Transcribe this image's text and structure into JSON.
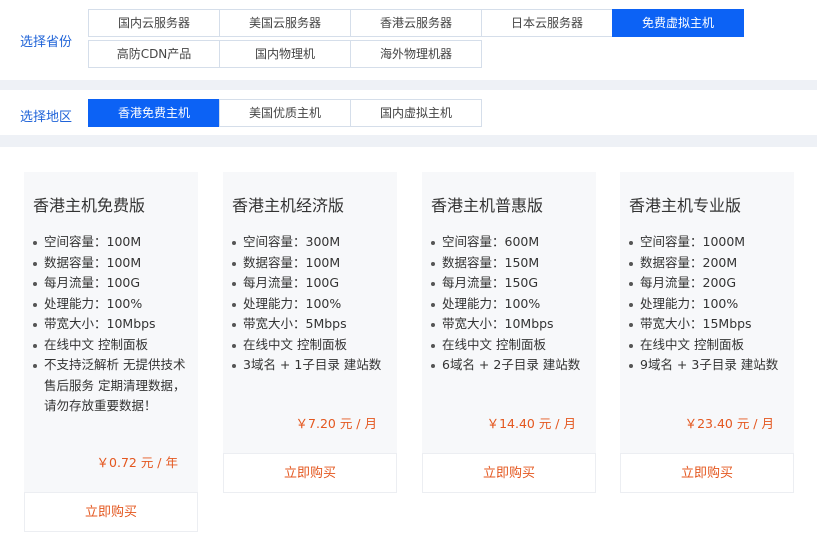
{
  "filters": {
    "province_label": "选择省份",
    "region_label": "选择地区",
    "province_tabs": [
      {
        "label": "国内云服务器",
        "active": false
      },
      {
        "label": "美国云服务器",
        "active": false
      },
      {
        "label": "香港云服务器",
        "active": false
      },
      {
        "label": "日本云服务器",
        "active": false
      },
      {
        "label": "免费虚拟主机",
        "active": true
      },
      {
        "label": "高防CDN产品",
        "active": false
      },
      {
        "label": "国内物理机",
        "active": false
      },
      {
        "label": "海外物理机器",
        "active": false
      }
    ],
    "region_tabs": [
      {
        "label": "香港免费主机",
        "active": true
      },
      {
        "label": "美国优质主机",
        "active": false
      },
      {
        "label": "国内虚拟主机",
        "active": false
      }
    ]
  },
  "plans": [
    {
      "title": "香港主机免费版",
      "features": [
        "空间容量：100M",
        "数据容量：100M",
        "每月流量：100G",
        "处理能力：100%",
        "带宽大小：10Mbps",
        "在线中文 控制面板",
        "不支持泛解析 无提供技术售后服务 定期清理数据，请勿存放重要数据！"
      ],
      "price": "￥0.72 元 / 年",
      "buy_label": "立即购买"
    },
    {
      "title": "香港主机经济版",
      "features": [
        "空间容量：300M",
        "数据容量：100M",
        "每月流量：100G",
        "处理能力：100%",
        "带宽大小：5Mbps",
        "在线中文 控制面板",
        "3域名 + 1子目录 建站数"
      ],
      "price": "￥7.20 元 / 月",
      "buy_label": "立即购买"
    },
    {
      "title": "香港主机普惠版",
      "features": [
        "空间容量：600M",
        "数据容量：150M",
        "每月流量：150G",
        "处理能力：100%",
        "带宽大小：10Mbps",
        "在线中文 控制面板",
        "6域名 + 2子目录 建站数"
      ],
      "price": "￥14.40 元 / 月",
      "buy_label": "立即购买"
    },
    {
      "title": "香港主机专业版",
      "features": [
        "空间容量：1000M",
        "数据容量：200M",
        "每月流量：200G",
        "处理能力：100%",
        "带宽大小：15Mbps",
        "在线中文 控制面板",
        "9域名 + 3子目录 建站数"
      ],
      "price": "￥23.40 元 / 月",
      "buy_label": "立即购买"
    }
  ],
  "colors": {
    "accent_blue": "#0c62f5",
    "price_orange": "#e4571f",
    "label_blue": "#1f63d8"
  }
}
